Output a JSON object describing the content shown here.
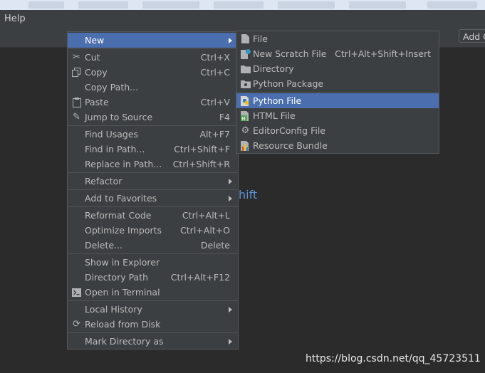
{
  "menubar": {
    "help": "Help"
  },
  "toolbar": {
    "add_button": "Add C"
  },
  "editor": {
    "hint": "hift"
  },
  "watermark": "https://blog.csdn.net/qq_45723511",
  "colors": {
    "menu_bg": "#3c3f41",
    "selection": "#4b6eaf",
    "editor_bg": "#2b2b2b",
    "hint_text": "#5b93d6"
  },
  "context_menu": {
    "new": "New",
    "cut": {
      "label": "Cut",
      "shortcut": "Ctrl+X"
    },
    "copy": {
      "label": "Copy",
      "shortcut": "Ctrl+C"
    },
    "copy_path": {
      "label": "Copy Path..."
    },
    "paste": {
      "label": "Paste",
      "shortcut": "Ctrl+V"
    },
    "jump_to_source": {
      "label": "Jump to Source",
      "shortcut": "F4"
    },
    "find_usages": {
      "label": "Find Usages",
      "shortcut": "Alt+F7"
    },
    "find_in_path": {
      "label": "Find in Path...",
      "shortcut": "Ctrl+Shift+F"
    },
    "replace_in_path": {
      "label": "Replace in Path...",
      "shortcut": "Ctrl+Shift+R"
    },
    "refactor": {
      "label": "Refactor"
    },
    "add_to_favorites": {
      "label": "Add to Favorites"
    },
    "reformat_code": {
      "label": "Reformat Code",
      "shortcut": "Ctrl+Alt+L"
    },
    "optimize_imports": {
      "label": "Optimize Imports",
      "shortcut": "Ctrl+Alt+O"
    },
    "delete": {
      "label": "Delete...",
      "shortcut": "Delete"
    },
    "show_in_explorer": {
      "label": "Show in Explorer"
    },
    "directory_path": {
      "label": "Directory Path",
      "shortcut": "Ctrl+Alt+F12"
    },
    "open_in_terminal": {
      "label": "Open in Terminal"
    },
    "local_history": {
      "label": "Local History"
    },
    "reload_from_disk": {
      "label": "Reload from Disk"
    },
    "mark_directory_as": {
      "label": "Mark Directory as"
    }
  },
  "new_submenu": {
    "file": {
      "label": "File",
      "icon": "file-icon"
    },
    "scratch": {
      "label": "New Scratch File",
      "shortcut": "Ctrl+Alt+Shift+Insert",
      "icon": "scratch-file-icon"
    },
    "directory": {
      "label": "Directory",
      "icon": "folder-icon"
    },
    "python_package": {
      "label": "Python Package",
      "icon": "package-icon"
    },
    "python_file": {
      "label": "Python File",
      "icon": "python-icon"
    },
    "html_file": {
      "label": "HTML File",
      "icon": "html-icon"
    },
    "editorconfig": {
      "label": "EditorConfig File",
      "icon": "gear-icon"
    },
    "resource_bundle": {
      "label": "Resource Bundle",
      "icon": "resource-bundle-icon"
    }
  }
}
